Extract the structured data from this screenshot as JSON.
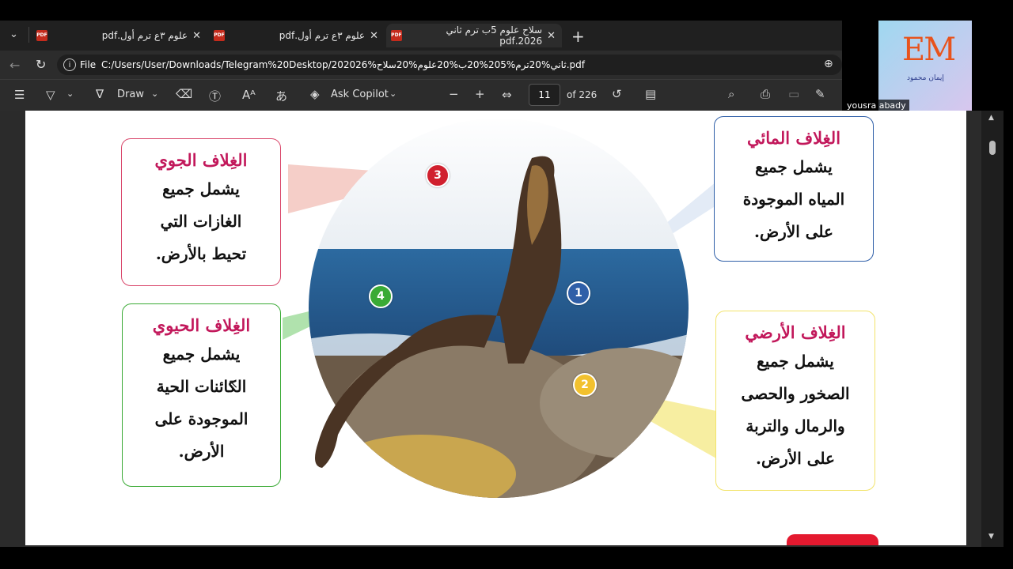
{
  "tabs": [
    {
      "label": "علوم ٣ع ترم أول.pdf",
      "active": false
    },
    {
      "label": "علوم ٣ع ترم أول.pdf",
      "active": false
    },
    {
      "label": "سلاح علوم 5ب ترم ثاني 2026.pdf",
      "active": true
    }
  ],
  "address": {
    "scheme_label": "File",
    "url": "C:/Users/User/Downloads/Telegram%20Desktop/202026%ثاني%20ترم%205%20ب%20علوم%20سلاح.pdf"
  },
  "toolbar": {
    "draw_label": "Draw",
    "copilot_label": "Ask Copilot",
    "page_current": "11",
    "page_total": "of 226"
  },
  "overlay": {
    "participant_name": "yousra abady",
    "logo_text": "EM",
    "logo_caption": "إيمان محمود"
  },
  "content": {
    "boxes": {
      "atmosphere": {
        "title": "الغِلاف الجوي",
        "lines": [
          "يشمل جميع",
          "الغازات التي",
          "تحيط بالأرض."
        ]
      },
      "biosphere": {
        "title": "الغِلاف الحيوي",
        "lines": [
          "يشمل جميع",
          "الكائنات الحية",
          "الموجودة على",
          "الأرض."
        ]
      },
      "hydrosphere": {
        "title": "الغِلاف المائي",
        "lines": [
          "يشمل جميع",
          "المياه الموجودة",
          "على الأرض."
        ]
      },
      "lithosphere": {
        "title": "الغِلاف الأرضي",
        "lines": [
          "يشمل جميع",
          "الصخور والحصى",
          "والرمال والتربة",
          "على الأرض."
        ]
      }
    },
    "markers": [
      "1",
      "2",
      "3",
      "4"
    ],
    "colors": {
      "marker1": "#2f5fa8",
      "marker2": "#f2c12e",
      "marker3": "#d0202e",
      "marker4": "#3aaa35",
      "title_color": "#c2185b"
    }
  }
}
